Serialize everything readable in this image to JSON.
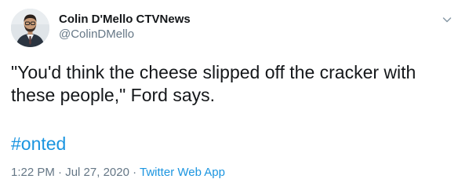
{
  "author": {
    "display_name": "Colin D'Mello CTVNews",
    "handle": "@ColinDMello",
    "avatar_icon": "profile-photo"
  },
  "tweet": {
    "text": "\"You'd think the cheese slipped off the cracker with these people,\" Ford says.",
    "hashtag": "#onted"
  },
  "meta": {
    "time": "1:22 PM",
    "separator": " · ",
    "date": "Jul 27, 2020",
    "source": "Twitter Web App"
  },
  "colors": {
    "link": "#1b95e0",
    "secondary": "#657786",
    "text": "#14171a"
  },
  "icons": {
    "menu": "chevron-down-icon"
  }
}
